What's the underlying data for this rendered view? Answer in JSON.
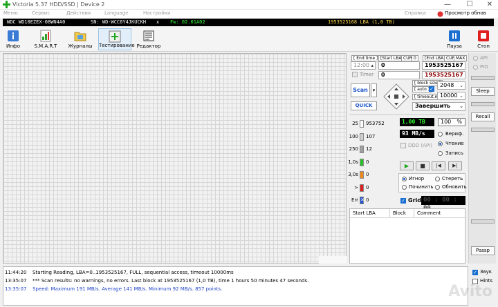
{
  "window": {
    "title": "Victoria 5.37 HDD/SSD | Device 2",
    "controls": [
      "—",
      "☐",
      "✕"
    ]
  },
  "menu": {
    "items": [
      "Меню",
      "Сервис",
      "Действия",
      "Language",
      "Настройки"
    ],
    "help": "Справка",
    "updates": "Просмотр обнов"
  },
  "drive": {
    "model": "WDC WD10EZEX-08WN4A0",
    "serial": "SN: WD-WCC6Y4JKUCKH",
    "close": "x",
    "firmware": "Fw: 02.01A02",
    "capacity": "1953525168 LBA (1,0 TB)"
  },
  "toolbar": {
    "info": "Инфо",
    "smart": "S.M.A.R.T",
    "journals": "Журналы",
    "testing": "Тестирование",
    "editor": "Редактор",
    "pause": "Пауза",
    "stop": "Стоп"
  },
  "scan": {
    "end_time_label": "[ End time ]",
    "end_time_value": "12:00",
    "timer_label": "Timer",
    "start_lba_label": "[Start LBA]",
    "cur_label": "CUR",
    "zero": "0",
    "start_lba_value": "0",
    "start_lba_value2": "0",
    "end_lba_label": "[End LBA]",
    "max_label": "MAX",
    "end_lba_value": "1953525167",
    "end_lba_value2": "1953525167",
    "scan_button": "Scan",
    "quick_button": "QUICK",
    "block_size_label": "[ block size ]",
    "auto_label": "[ auto ]",
    "block_size_value": "2048",
    "timeout_label": "[ timeout,ms ]",
    "timeout_value": "10000",
    "end_action": "Завершить"
  },
  "stats": {
    "rows": [
      {
        "label": "25",
        "value": "953752",
        "color": "#ffffff"
      },
      {
        "label": "100",
        "value": "107",
        "color": "#d0d0d0"
      },
      {
        "label": "250",
        "value": "12",
        "color": "#a0a0a0"
      },
      {
        "label": "1,0s",
        "value": "0",
        "color": "#2fc02f"
      },
      {
        "label": "3,0s",
        "value": "0",
        "color": "#f08a1c"
      },
      {
        "label": ">",
        "value": "0",
        "color": "#e02020"
      },
      {
        "label": "Err",
        "value": "0",
        "color": "#2050d0"
      }
    ],
    "err_mark": "✕"
  },
  "progress": {
    "size": "1,00 ТВ",
    "percent": "100",
    "percent_sign": "%",
    "speed": "93 MB/s",
    "ddd_label": "DDD (API)"
  },
  "mode": {
    "verify": "Вериф.",
    "read": "Чтение",
    "write": "Запись",
    "selected": "read"
  },
  "player": {
    "play": "▶",
    "stop": "■",
    "prev": "|◀",
    "next": "▶|"
  },
  "repair": {
    "ignore": "Игнор",
    "erase": "Стереть",
    "repair": "Починить",
    "update": "Обновить"
  },
  "grid_toggle": {
    "label": "Grid",
    "timer": "00 : 00 : 00"
  },
  "table": {
    "columns": [
      "Start LBA",
      "Block",
      "Comment"
    ]
  },
  "side": {
    "api": "API",
    "pio": "PIO",
    "sleep": "Sleep",
    "recall": "Recall",
    "passp": "Passp",
    "sound": "Звук",
    "hints": "Hints"
  },
  "log": {
    "lines": [
      {
        "time": "11:44:20",
        "message": "Starting Reading, LBA=0..1953525167, FULL, sequential access, timeout 10000ms",
        "color": "#000000"
      },
      {
        "time": "13:35:07",
        "message": "*** Scan results: no warnings, no errors. Last block at 1953525167 (1,0 TB), time 1 hours 50 minutes 47 seconds.",
        "color": "#000000"
      },
      {
        "time": "13:35:07",
        "message": "Speed: Maximum 191 MB/s. Average 141 MB/s. Minimum 92 MB/s. 857 points.",
        "color": "#1f44c8"
      }
    ]
  },
  "watermark": "Avito",
  "colors": {
    "lcd_green": "#33ff33",
    "lcd_white": "#ffffff",
    "accent_blue": "#1a55c8",
    "stop_red": "#e02020"
  }
}
